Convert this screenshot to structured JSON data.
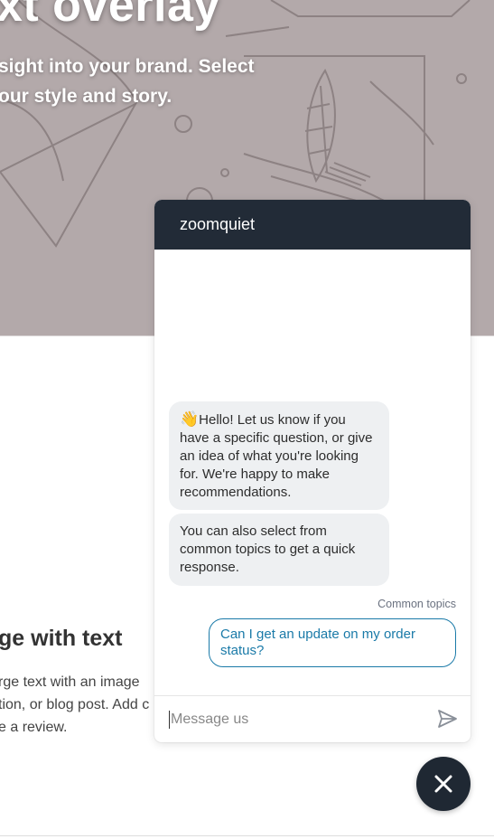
{
  "hero": {
    "title": "xt overlay",
    "subtitle_line1": "sight into your brand. Select",
    "subtitle_line2": "our style and story."
  },
  "section": {
    "title": "ge with text",
    "body_line1": "rge text with an image",
    "body_line2": "tion, or blog post. Add c",
    "body_line3": "e a review."
  },
  "chat": {
    "header_title": "zoomquiet",
    "messages": [
      {
        "emoji": "👋",
        "text": "Hello! Let us know if you have a specific question, or give an idea of what you're looking for. We're happy to make recommendations."
      },
      {
        "text": "You can also select from common topics to get a quick response."
      }
    ],
    "topics_label": "Common topics",
    "topics": [
      {
        "label": "Can I get an update on my order status?"
      }
    ],
    "input_placeholder": "Message us"
  },
  "icons": {
    "send": "send-icon",
    "close": "close-icon"
  },
  "colors": {
    "hero_bg": "#b3a9aa",
    "header_bg": "#222b37",
    "accent": "#1a7aa8",
    "fab_bg": "#1f2833"
  }
}
